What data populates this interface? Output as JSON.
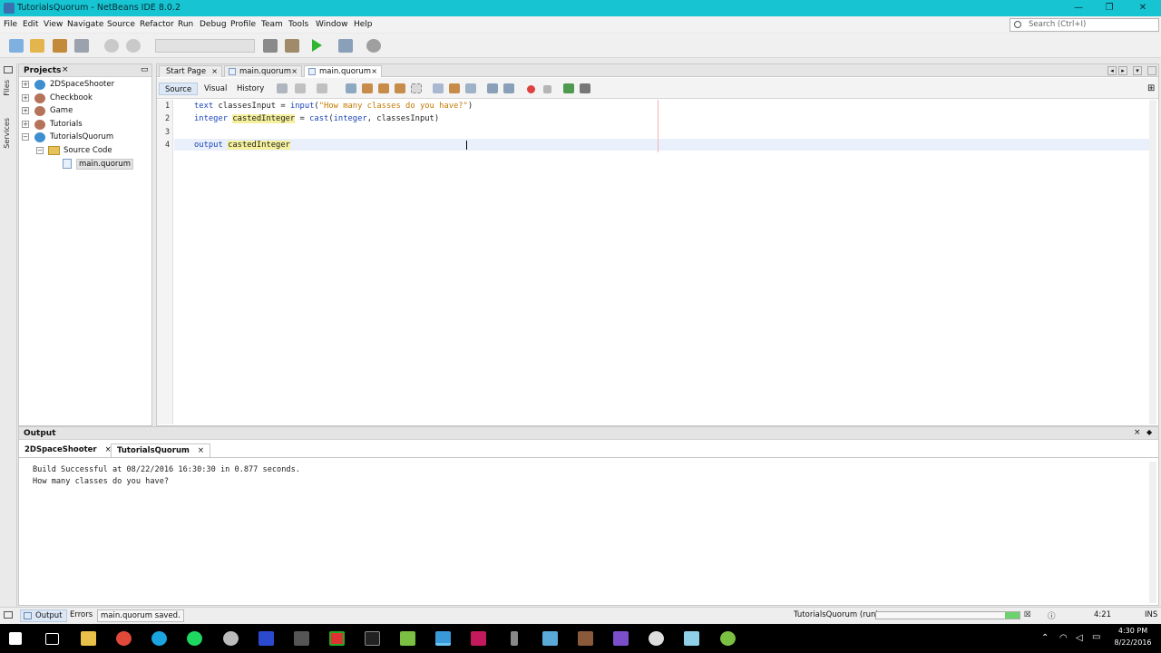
{
  "window": {
    "title": "TutorialsQuorum - NetBeans IDE 8.0.2",
    "min": "—",
    "restore": "❐",
    "close": "✕"
  },
  "menu": [
    "File",
    "Edit",
    "View",
    "Navigate",
    "Source",
    "Refactor",
    "Run",
    "Debug",
    "Profile",
    "Team",
    "Tools",
    "Window",
    "Help"
  ],
  "search": {
    "placeholder": "Search (Ctrl+I)"
  },
  "side_tabs": {
    "files": "Files",
    "services": "Services"
  },
  "projects": {
    "title": "Projects",
    "close": "×",
    "minimize": "▭",
    "items": [
      {
        "label": "2DSpaceShooter",
        "expand": "+"
      },
      {
        "label": "Checkbook",
        "expand": "+"
      },
      {
        "label": "Game",
        "expand": "+"
      },
      {
        "label": "Tutorials",
        "expand": "+"
      },
      {
        "label": "TutorialsQuorum",
        "expand": "−"
      },
      {
        "label": "Source Code",
        "expand": "−"
      },
      {
        "label": "main.quorum",
        "expand": ""
      }
    ]
  },
  "editor": {
    "tabs": [
      {
        "label": "Start Page",
        "close": "×"
      },
      {
        "label": "main.quorum",
        "close": "×"
      },
      {
        "label": "main.quorum",
        "close": "×"
      }
    ],
    "views": [
      "Source",
      "Visual",
      "History"
    ],
    "line_numbers": [
      "1",
      "2",
      "3",
      "4"
    ],
    "code": {
      "l1": {
        "kw1": "text",
        "a": " classesInput = ",
        "fn": "input",
        "b": "(",
        "str": "\"How many classes do you have?\"",
        "c": ")"
      },
      "l2": {
        "kw1": "integer",
        "a": " ",
        "var": "castedInteger",
        "b": " = ",
        "fn": "cast",
        "c": "(",
        "kw2": "integer",
        "d": ", classesInput)"
      },
      "l4": {
        "kw1": "output",
        "a": " ",
        "var": "castedInteger"
      }
    }
  },
  "output": {
    "title": "Output",
    "close": "×",
    "pin": "◆",
    "tabs": [
      {
        "label": "2DSpaceShooter",
        "close": "×"
      },
      {
        "label": "TutorialsQuorum",
        "close": "×"
      }
    ],
    "lines": [
      "Build Successful at 08/22/2016 16:30:30 in 0.877 seconds.",
      "How many classes do you have?"
    ]
  },
  "status": {
    "output_tab": "Output",
    "errors_tab": "Errors",
    "message": "main.quorum saved.",
    "run_task": "TutorialsQuorum (run)",
    "progress_fraction": 0.1,
    "position": "4:21",
    "mode": "INS"
  },
  "taskbar": {
    "time": "4:30 PM",
    "date": "8/22/2016",
    "icons": [
      "windows-start",
      "task-view",
      "file-explorer",
      "chrome",
      "skype",
      "spotify",
      "netbeans-alt",
      "mercurial",
      "lantern",
      "terminal",
      "notepad",
      "netbeans",
      "jetbrains",
      "pen-tool",
      "sourcetree",
      "winrar",
      "visual-studio",
      "unity",
      "launcher",
      "android-studio"
    ]
  },
  "colors": {
    "accent": "#16c4d2",
    "keyword": "#1a44b8",
    "string": "#c37a00",
    "highlight": "#f4f09c"
  }
}
